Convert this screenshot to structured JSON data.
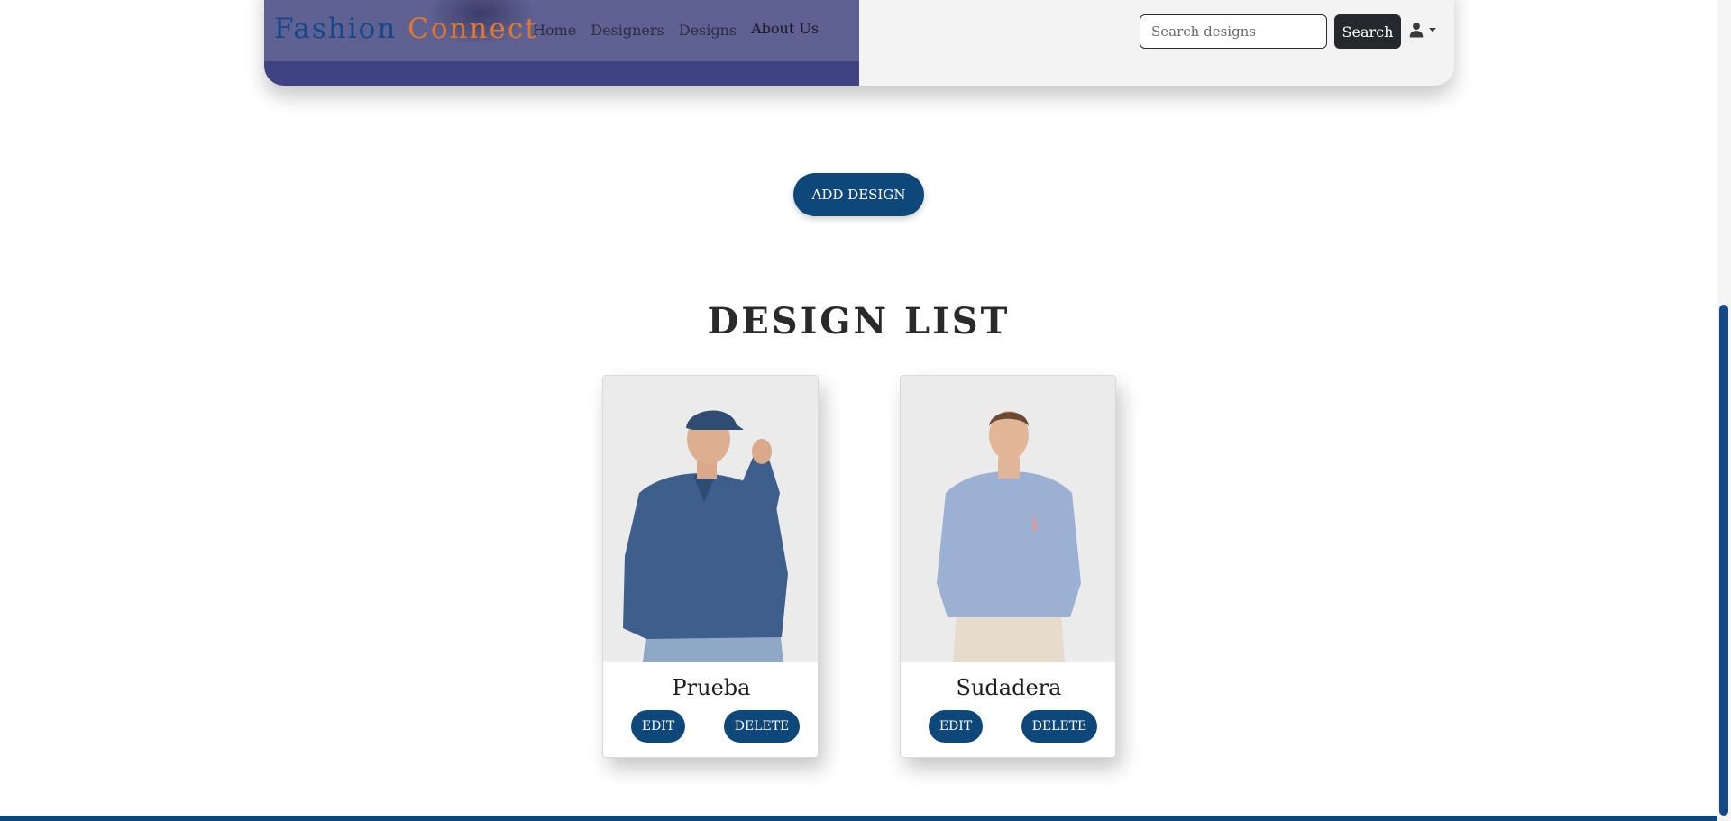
{
  "header": {
    "brand_part1": "Fashion",
    "brand_part2": "Connect",
    "nav": [
      "Home",
      "Designers",
      "Designs",
      "About Us"
    ],
    "search_placeholder": "Search designs",
    "search_button": "Search",
    "user_icon": "user-icon",
    "caret_icon": "caret-down-icon"
  },
  "main": {
    "add_button": "ADD DESIGN",
    "list_title": "DESIGN LIST",
    "designs": [
      {
        "name": "Prueba",
        "edit": "EDIT",
        "delete": "DELETE"
      },
      {
        "name": "Sudadera",
        "edit": "EDIT",
        "delete": "DELETE"
      }
    ]
  },
  "colors": {
    "primary": "#0e487a",
    "brand_blue": "#14488a",
    "brand_orange": "#e0782f",
    "hero": "#3f4283"
  }
}
